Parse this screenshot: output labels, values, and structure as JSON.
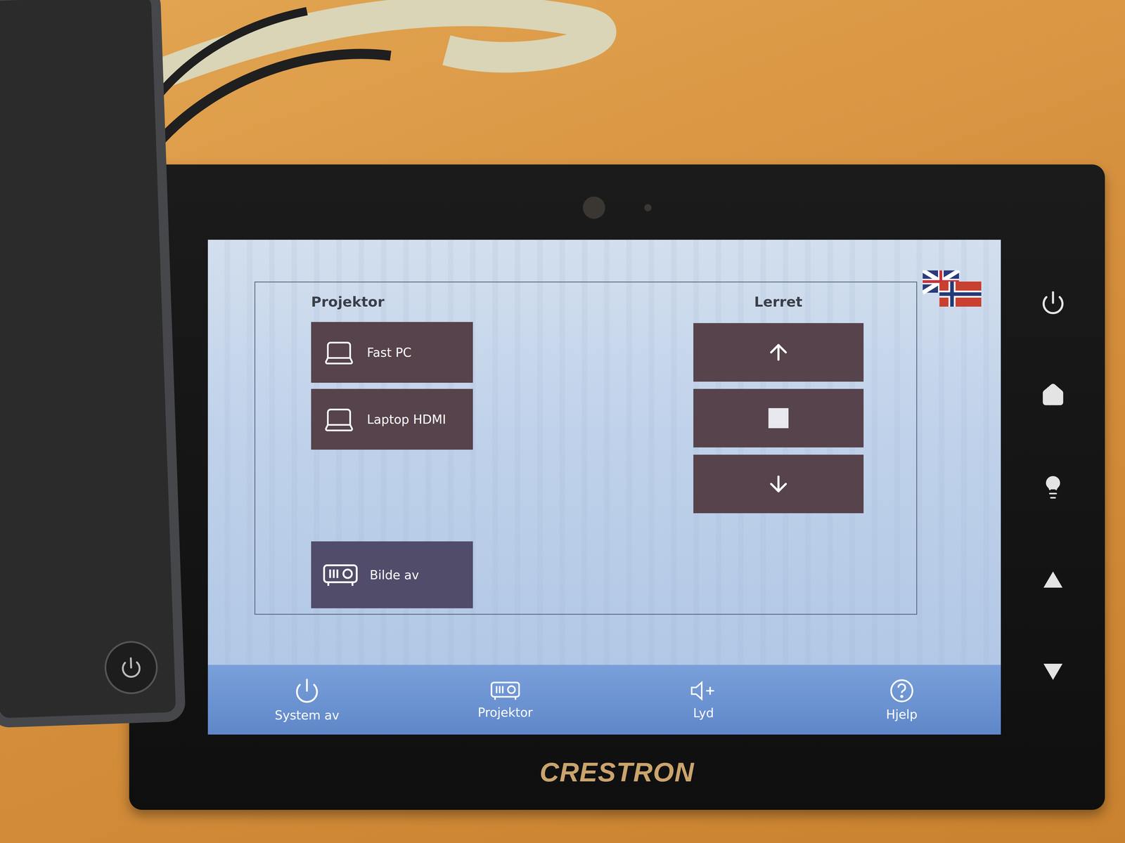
{
  "screen": {
    "projector_panel": {
      "title": "Projektor",
      "sources": [
        {
          "label": "Fast PC",
          "selected": false
        },
        {
          "label": "Laptop HDMI",
          "selected": false
        }
      ],
      "blank_button": {
        "label": "Bilde av"
      }
    },
    "screen_panel": {
      "title": "Lerret",
      "controls": [
        {
          "kind": "up"
        },
        {
          "kind": "stop"
        },
        {
          "kind": "down"
        }
      ]
    },
    "nav": [
      {
        "label": "System av",
        "kind": "power"
      },
      {
        "label": "Projektor",
        "kind": "projector"
      },
      {
        "label": "Lyd",
        "kind": "sound"
      },
      {
        "label": "Hjelp",
        "kind": "help"
      }
    ]
  },
  "hardware_buttons": [
    {
      "kind": "power"
    },
    {
      "kind": "home"
    },
    {
      "kind": "light"
    },
    {
      "kind": "up"
    },
    {
      "kind": "down"
    }
  ],
  "brand": "CRESTRON"
}
